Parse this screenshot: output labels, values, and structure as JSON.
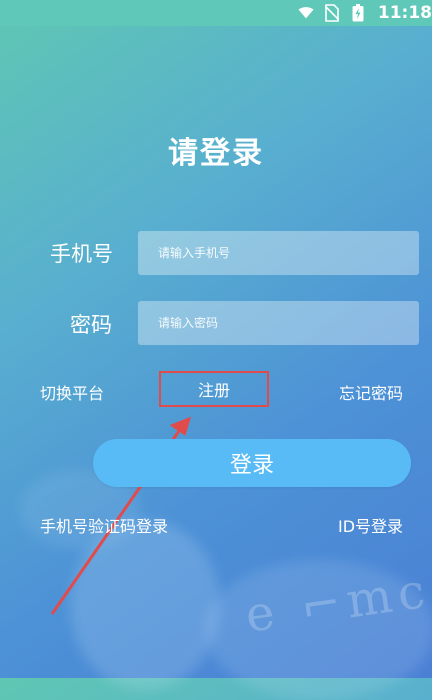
{
  "status_bar": {
    "time": "11:18",
    "icons": [
      "wifi-icon",
      "no-sim-icon",
      "battery-icon"
    ]
  },
  "login": {
    "title": "请登录",
    "phone_label": "手机号",
    "phone_placeholder": "请输入手机号",
    "password_label": "密码",
    "password_placeholder": "请输入密码",
    "switch_platform": "切换平台",
    "register": "注册",
    "forgot_password": "忘记密码",
    "login_button": "登录",
    "sms_login": "手机号验证码登录",
    "id_login": "ID号登录"
  },
  "colors": {
    "gradient_start": "#5fc7b3",
    "gradient_end": "#4a7fd4",
    "button_blue": "#59bbf6",
    "annotation_red": "#e14b4b"
  },
  "annotation": {
    "highlight": "register-box",
    "arrow": "red-arrow-pointing-to-register"
  }
}
